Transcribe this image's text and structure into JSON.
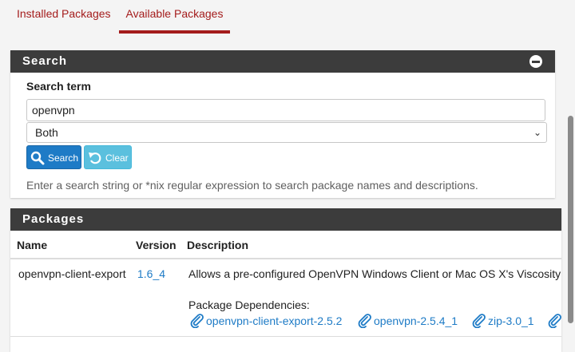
{
  "tabs": {
    "installed": "Installed Packages",
    "available": "Available Packages"
  },
  "search": {
    "heading": "Search",
    "term_label": "Search term",
    "term_value": "openvpn",
    "scope_selected": "Both",
    "search_button": "Search",
    "clear_button": "Clear",
    "help": "Enter a search string or *nix regular expression to search package names and descriptions."
  },
  "packages": {
    "heading": "Packages",
    "columns": [
      "Name",
      "Version",
      "Description"
    ],
    "rows": [
      {
        "name": "openvpn-client-export",
        "version": "1.6_4",
        "description": "Allows a pre-configured OpenVPN Windows Client or Mac OS X's Viscosity",
        "deps_label": "Package Dependencies:",
        "deps": [
          "openvpn-client-export-2.5.2",
          "openvpn-2.5.4_1",
          "zip-3.0_1"
        ]
      }
    ]
  },
  "colors": {
    "accent_red": "#a41c1c",
    "heading_bg": "#3c3c3c",
    "link_blue": "#1e7bc6",
    "clear_btn": "#5bc0de"
  }
}
